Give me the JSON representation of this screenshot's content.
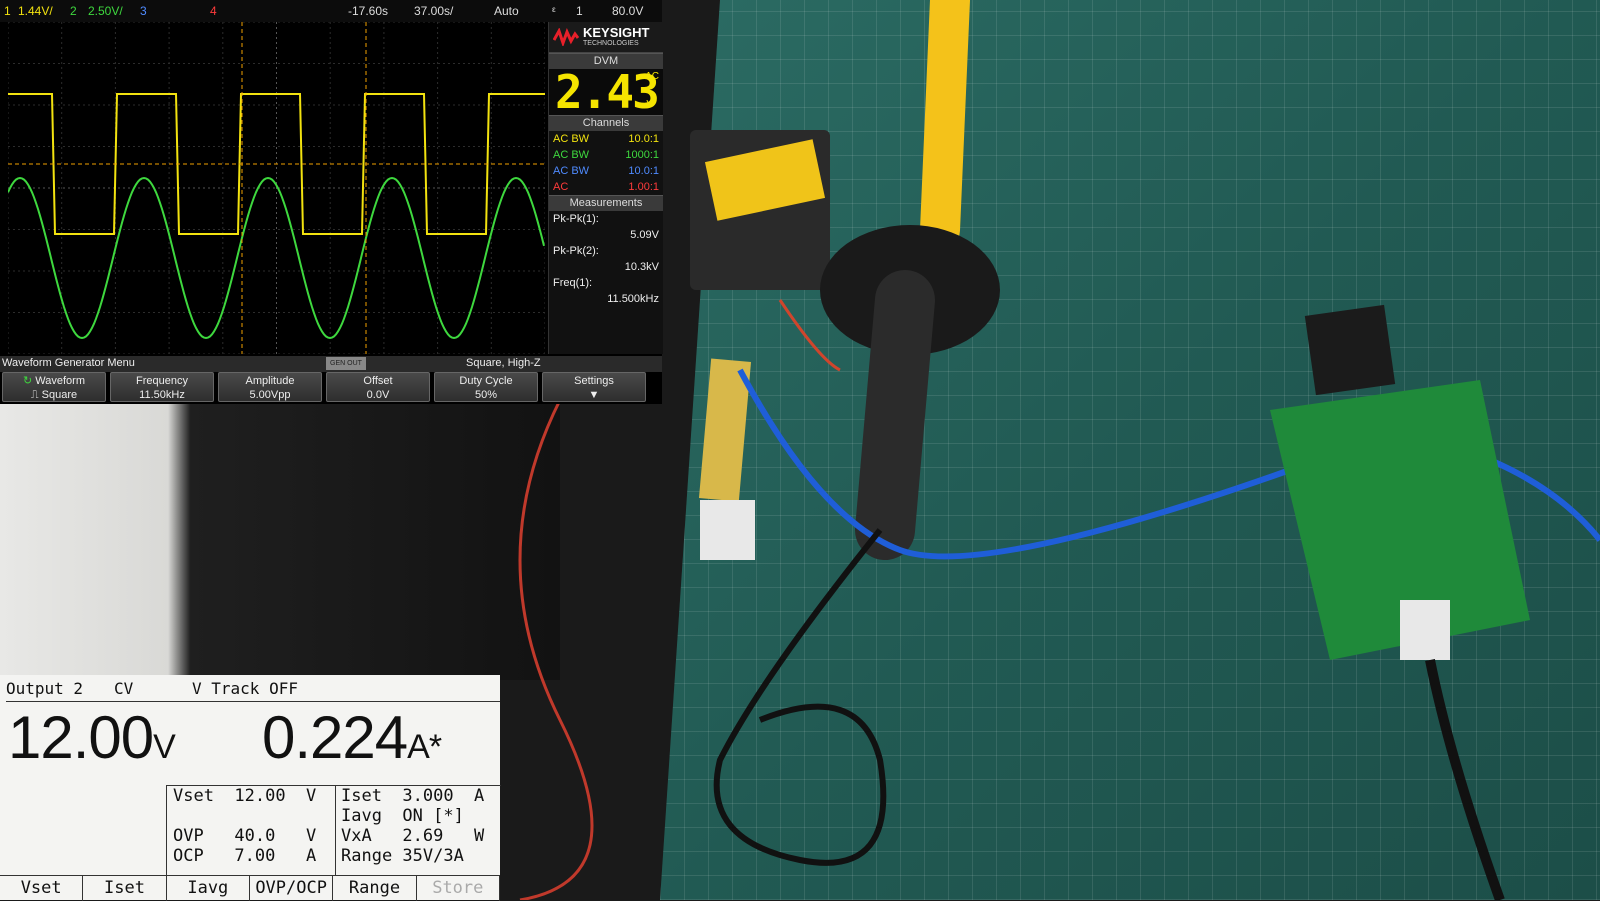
{
  "scope": {
    "topbar": {
      "ch1_scale": "1.44V/",
      "ch2_num": "2",
      "ch2_scale": "2.50V/",
      "ch3_num": "3",
      "ch4_num": "4",
      "time_pos": "-17.60s",
      "time_scale": "37.00s/",
      "trig_mode": "Auto",
      "trig_src": "1",
      "trig_level": "80.0V"
    },
    "brand": {
      "name": "KEYSIGHT",
      "sub": "TECHNOLOGIES"
    },
    "dvm": {
      "header": "DVM",
      "value": "2.43",
      "unit_top": "AC",
      "unit": "V"
    },
    "channels": {
      "header": "Channels",
      "rows": [
        {
          "coupling": "AC BW",
          "ratio": "10.0:1",
          "color": "#f2e20f"
        },
        {
          "coupling": "AC BW",
          "ratio": "1000:1",
          "color": "#3ed83e"
        },
        {
          "coupling": "AC BW",
          "ratio": "10.0:1",
          "color": "#4f8bff"
        },
        {
          "coupling": "AC",
          "ratio": "1.00:1",
          "color": "#ff3b3b"
        }
      ]
    },
    "measurements": {
      "header": "Measurements",
      "items": [
        {
          "label": "Pk-Pk(1):",
          "value": "5.09V"
        },
        {
          "label": "Pk-Pk(2):",
          "value": "10.3kV"
        },
        {
          "label": "Freq(1):",
          "value": "11.500kHz"
        }
      ]
    },
    "menu": {
      "title": "Waveform Generator Menu",
      "gen_label": "GEN OUT",
      "mode": "Square, High-Z"
    },
    "softkeys": [
      {
        "label": "Waveform",
        "value": "Square"
      },
      {
        "label": "Frequency",
        "value": "11.50kHz"
      },
      {
        "label": "Amplitude",
        "value": "5.00Vpp"
      },
      {
        "label": "Offset",
        "value": "0.0V"
      },
      {
        "label": "Duty Cycle",
        "value": "50%"
      },
      {
        "label": "Settings",
        "value": ""
      }
    ],
    "trace_colors": {
      "ch1": "#f2e20f",
      "ch2": "#3ed83e",
      "cursor": "#f0a000"
    }
  },
  "psu": {
    "status": {
      "output": "Output 2",
      "mode": "CV",
      "track": "V Track OFF"
    },
    "voltage": "12.00",
    "voltage_unit": "V",
    "current": "0.224",
    "current_unit": "A*",
    "rows": {
      "vset": "Vset  12.00  V",
      "ovp": "OVP   40.0   V",
      "ocp": "OCP   7.00   A",
      "iset": "Iset  3.000  A",
      "iavg": "Iavg  ON [*]",
      "vxa": "VxA   2.69   W",
      "range": "Range 35V/3A"
    },
    "keys": [
      "Vset",
      "Iset",
      "Iavg",
      "OVP/OCP",
      "Range",
      "Store"
    ]
  }
}
